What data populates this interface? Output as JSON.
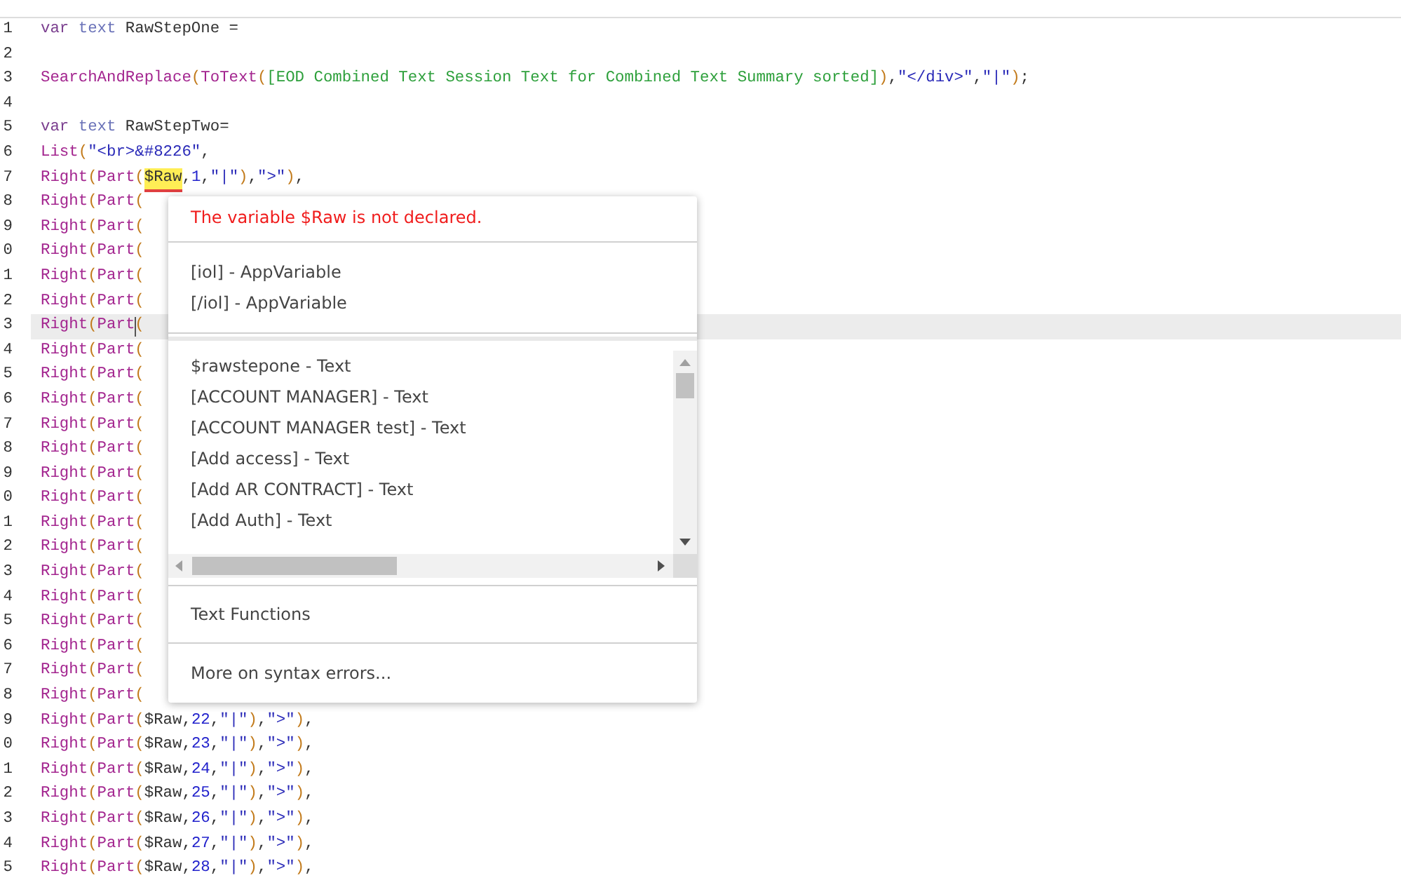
{
  "editor": {
    "lines": [
      {
        "number": "1",
        "current": false,
        "tokens": [
          {
            "kind": "keyword",
            "text": "var "
          },
          {
            "kind": "type",
            "text": "text"
          },
          {
            "kind": "plain",
            "text": " RawStepOne ="
          }
        ]
      },
      {
        "number": "2",
        "current": false
      },
      {
        "number": "3",
        "current": false,
        "tokens": [
          {
            "kind": "function",
            "text": "SearchAndReplace"
          },
          {
            "kind": "paren",
            "text": "("
          },
          {
            "kind": "function",
            "text": "ToText"
          },
          {
            "kind": "paren",
            "text": "("
          },
          {
            "kind": "field",
            "text": "[EOD Combined Text Session Text for Combined Text Summary sorted]"
          },
          {
            "kind": "paren",
            "text": ")"
          },
          {
            "kind": "plain",
            "text": ","
          },
          {
            "kind": "string",
            "text": "\"</div>\""
          },
          {
            "kind": "plain",
            "text": ","
          },
          {
            "kind": "string",
            "text": "\"|\""
          },
          {
            "kind": "paren",
            "text": ")"
          },
          {
            "kind": "plain",
            "text": ";"
          }
        ]
      },
      {
        "number": "4",
        "current": false
      },
      {
        "number": "5",
        "current": false,
        "tokens": [
          {
            "kind": "keyword",
            "text": "var "
          },
          {
            "kind": "type",
            "text": "text"
          },
          {
            "kind": "plain",
            "text": " RawStepTwo="
          }
        ]
      },
      {
        "number": "6",
        "current": false,
        "tokens": [
          {
            "kind": "function",
            "text": "List"
          },
          {
            "kind": "paren",
            "text": "("
          },
          {
            "kind": "string",
            "text": "\"<br>&#8226\""
          },
          {
            "kind": "plain",
            "text": ","
          }
        ]
      },
      {
        "number": "7",
        "current": false,
        "tokens": [
          {
            "kind": "function",
            "text": "Right"
          },
          {
            "kind": "paren",
            "text": "("
          },
          {
            "kind": "function",
            "text": "Part"
          },
          {
            "kind": "paren",
            "text": "("
          },
          {
            "kind": "error",
            "text": "$Raw"
          },
          {
            "kind": "plain",
            "text": ","
          },
          {
            "kind": "number",
            "text": "1"
          },
          {
            "kind": "plain",
            "text": ","
          },
          {
            "kind": "string",
            "text": "\"|\""
          },
          {
            "kind": "paren",
            "text": ")"
          },
          {
            "kind": "plain",
            "text": ","
          },
          {
            "kind": "string",
            "text": "\">\""
          },
          {
            "kind": "paren",
            "text": ")"
          },
          {
            "kind": "plain",
            "text": ","
          }
        ]
      },
      {
        "number": "8",
        "current": false,
        "tokens": [
          {
            "kind": "function",
            "text": "Right"
          },
          {
            "kind": "paren",
            "text": "("
          },
          {
            "kind": "function",
            "text": "Part"
          },
          {
            "kind": "paren",
            "text": "("
          }
        ]
      },
      {
        "number": "9",
        "current": false,
        "tokens": [
          {
            "kind": "function",
            "text": "Right"
          },
          {
            "kind": "paren",
            "text": "("
          },
          {
            "kind": "function",
            "text": "Part"
          },
          {
            "kind": "paren",
            "text": "("
          }
        ]
      },
      {
        "number": "0",
        "current": false,
        "tokens": [
          {
            "kind": "function",
            "text": "Right"
          },
          {
            "kind": "paren",
            "text": "("
          },
          {
            "kind": "function",
            "text": "Part"
          },
          {
            "kind": "paren",
            "text": "("
          }
        ]
      },
      {
        "number": "1",
        "current": false,
        "tokens": [
          {
            "kind": "function",
            "text": "Right"
          },
          {
            "kind": "paren",
            "text": "("
          },
          {
            "kind": "function",
            "text": "Part"
          },
          {
            "kind": "paren",
            "text": "("
          }
        ]
      },
      {
        "number": "2",
        "current": false,
        "tokens": [
          {
            "kind": "function",
            "text": "Right"
          },
          {
            "kind": "paren",
            "text": "("
          },
          {
            "kind": "function",
            "text": "Part"
          },
          {
            "kind": "paren",
            "text": "("
          }
        ]
      },
      {
        "number": "3",
        "current": true,
        "tokens": [
          {
            "kind": "function",
            "text": "Right"
          },
          {
            "kind": "paren",
            "text": "("
          },
          {
            "kind": "function",
            "text": "Part"
          },
          {
            "kind": "paren",
            "text": "("
          }
        ]
      },
      {
        "number": "4",
        "current": false,
        "tokens": [
          {
            "kind": "function",
            "text": "Right"
          },
          {
            "kind": "paren",
            "text": "("
          },
          {
            "kind": "function",
            "text": "Part"
          },
          {
            "kind": "paren",
            "text": "("
          }
        ]
      },
      {
        "number": "5",
        "current": false,
        "tokens": [
          {
            "kind": "function",
            "text": "Right"
          },
          {
            "kind": "paren",
            "text": "("
          },
          {
            "kind": "function",
            "text": "Part"
          },
          {
            "kind": "paren",
            "text": "("
          }
        ]
      },
      {
        "number": "6",
        "current": false,
        "tokens": [
          {
            "kind": "function",
            "text": "Right"
          },
          {
            "kind": "paren",
            "text": "("
          },
          {
            "kind": "function",
            "text": "Part"
          },
          {
            "kind": "paren",
            "text": "("
          }
        ]
      },
      {
        "number": "7",
        "current": false,
        "tokens": [
          {
            "kind": "function",
            "text": "Right"
          },
          {
            "kind": "paren",
            "text": "("
          },
          {
            "kind": "function",
            "text": "Part"
          },
          {
            "kind": "paren",
            "text": "("
          }
        ]
      },
      {
        "number": "8",
        "current": false,
        "tokens": [
          {
            "kind": "function",
            "text": "Right"
          },
          {
            "kind": "paren",
            "text": "("
          },
          {
            "kind": "function",
            "text": "Part"
          },
          {
            "kind": "paren",
            "text": "("
          }
        ]
      },
      {
        "number": "9",
        "current": false,
        "tokens": [
          {
            "kind": "function",
            "text": "Right"
          },
          {
            "kind": "paren",
            "text": "("
          },
          {
            "kind": "function",
            "text": "Part"
          },
          {
            "kind": "paren",
            "text": "("
          }
        ]
      },
      {
        "number": "0",
        "current": false,
        "tokens": [
          {
            "kind": "function",
            "text": "Right"
          },
          {
            "kind": "paren",
            "text": "("
          },
          {
            "kind": "function",
            "text": "Part"
          },
          {
            "kind": "paren",
            "text": "("
          }
        ]
      },
      {
        "number": "1",
        "current": false,
        "tokens": [
          {
            "kind": "function",
            "text": "Right"
          },
          {
            "kind": "paren",
            "text": "("
          },
          {
            "kind": "function",
            "text": "Part"
          },
          {
            "kind": "paren",
            "text": "("
          }
        ]
      },
      {
        "number": "2",
        "current": false,
        "tokens": [
          {
            "kind": "function",
            "text": "Right"
          },
          {
            "kind": "paren",
            "text": "("
          },
          {
            "kind": "function",
            "text": "Part"
          },
          {
            "kind": "paren",
            "text": "("
          }
        ]
      },
      {
        "number": "3",
        "current": false,
        "tokens": [
          {
            "kind": "function",
            "text": "Right"
          },
          {
            "kind": "paren",
            "text": "("
          },
          {
            "kind": "function",
            "text": "Part"
          },
          {
            "kind": "paren",
            "text": "("
          }
        ]
      },
      {
        "number": "4",
        "current": false,
        "tokens": [
          {
            "kind": "function",
            "text": "Right"
          },
          {
            "kind": "paren",
            "text": "("
          },
          {
            "kind": "function",
            "text": "Part"
          },
          {
            "kind": "paren",
            "text": "("
          }
        ]
      },
      {
        "number": "5",
        "current": false,
        "tokens": [
          {
            "kind": "function",
            "text": "Right"
          },
          {
            "kind": "paren",
            "text": "("
          },
          {
            "kind": "function",
            "text": "Part"
          },
          {
            "kind": "paren",
            "text": "("
          }
        ]
      },
      {
        "number": "6",
        "current": false,
        "tokens": [
          {
            "kind": "function",
            "text": "Right"
          },
          {
            "kind": "paren",
            "text": "("
          },
          {
            "kind": "function",
            "text": "Part"
          },
          {
            "kind": "paren",
            "text": "("
          }
        ]
      },
      {
        "number": "7",
        "current": false,
        "tokens": [
          {
            "kind": "function",
            "text": "Right"
          },
          {
            "kind": "paren",
            "text": "("
          },
          {
            "kind": "function",
            "text": "Part"
          },
          {
            "kind": "paren",
            "text": "("
          }
        ]
      },
      {
        "number": "8",
        "current": false,
        "tokens": [
          {
            "kind": "function",
            "text": "Right"
          },
          {
            "kind": "paren",
            "text": "("
          },
          {
            "kind": "function",
            "text": "Part"
          },
          {
            "kind": "paren",
            "text": "("
          }
        ]
      },
      {
        "number": "9",
        "current": false,
        "tokens": [
          {
            "kind": "function",
            "text": "Right"
          },
          {
            "kind": "paren",
            "text": "("
          },
          {
            "kind": "function",
            "text": "Part"
          },
          {
            "kind": "paren",
            "text": "("
          },
          {
            "kind": "plain",
            "text": "$Raw,"
          },
          {
            "kind": "number",
            "text": "22"
          },
          {
            "kind": "plain",
            "text": ","
          },
          {
            "kind": "string",
            "text": "\"|\""
          },
          {
            "kind": "paren",
            "text": ")"
          },
          {
            "kind": "plain",
            "text": ","
          },
          {
            "kind": "string",
            "text": "\">\""
          },
          {
            "kind": "paren",
            "text": ")"
          },
          {
            "kind": "plain",
            "text": ","
          }
        ]
      },
      {
        "number": "0",
        "current": false,
        "tokens": [
          {
            "kind": "function",
            "text": "Right"
          },
          {
            "kind": "paren",
            "text": "("
          },
          {
            "kind": "function",
            "text": "Part"
          },
          {
            "kind": "paren",
            "text": "("
          },
          {
            "kind": "plain",
            "text": "$Raw,"
          },
          {
            "kind": "number",
            "text": "23"
          },
          {
            "kind": "plain",
            "text": ","
          },
          {
            "kind": "string",
            "text": "\"|\""
          },
          {
            "kind": "paren",
            "text": ")"
          },
          {
            "kind": "plain",
            "text": ","
          },
          {
            "kind": "string",
            "text": "\">\""
          },
          {
            "kind": "paren",
            "text": ")"
          },
          {
            "kind": "plain",
            "text": ","
          }
        ]
      },
      {
        "number": "1",
        "current": false,
        "tokens": [
          {
            "kind": "function",
            "text": "Right"
          },
          {
            "kind": "paren",
            "text": "("
          },
          {
            "kind": "function",
            "text": "Part"
          },
          {
            "kind": "paren",
            "text": "("
          },
          {
            "kind": "plain",
            "text": "$Raw,"
          },
          {
            "kind": "number",
            "text": "24"
          },
          {
            "kind": "plain",
            "text": ","
          },
          {
            "kind": "string",
            "text": "\"|\""
          },
          {
            "kind": "paren",
            "text": ")"
          },
          {
            "kind": "plain",
            "text": ","
          },
          {
            "kind": "string",
            "text": "\">\""
          },
          {
            "kind": "paren",
            "text": ")"
          },
          {
            "kind": "plain",
            "text": ","
          }
        ]
      },
      {
        "number": "2",
        "current": false,
        "tokens": [
          {
            "kind": "function",
            "text": "Right"
          },
          {
            "kind": "paren",
            "text": "("
          },
          {
            "kind": "function",
            "text": "Part"
          },
          {
            "kind": "paren",
            "text": "("
          },
          {
            "kind": "plain",
            "text": "$Raw,"
          },
          {
            "kind": "number",
            "text": "25"
          },
          {
            "kind": "plain",
            "text": ","
          },
          {
            "kind": "string",
            "text": "\"|\""
          },
          {
            "kind": "paren",
            "text": ")"
          },
          {
            "kind": "plain",
            "text": ","
          },
          {
            "kind": "string",
            "text": "\">\""
          },
          {
            "kind": "paren",
            "text": ")"
          },
          {
            "kind": "plain",
            "text": ","
          }
        ]
      },
      {
        "number": "3",
        "current": false,
        "tokens": [
          {
            "kind": "function",
            "text": "Right"
          },
          {
            "kind": "paren",
            "text": "("
          },
          {
            "kind": "function",
            "text": "Part"
          },
          {
            "kind": "paren",
            "text": "("
          },
          {
            "kind": "plain",
            "text": "$Raw,"
          },
          {
            "kind": "number",
            "text": "26"
          },
          {
            "kind": "plain",
            "text": ","
          },
          {
            "kind": "string",
            "text": "\"|\""
          },
          {
            "kind": "paren",
            "text": ")"
          },
          {
            "kind": "plain",
            "text": ","
          },
          {
            "kind": "string",
            "text": "\">\""
          },
          {
            "kind": "paren",
            "text": ")"
          },
          {
            "kind": "plain",
            "text": ","
          }
        ]
      },
      {
        "number": "4",
        "current": false,
        "tokens": [
          {
            "kind": "function",
            "text": "Right"
          },
          {
            "kind": "paren",
            "text": "("
          },
          {
            "kind": "function",
            "text": "Part"
          },
          {
            "kind": "paren",
            "text": "("
          },
          {
            "kind": "plain",
            "text": "$Raw,"
          },
          {
            "kind": "number",
            "text": "27"
          },
          {
            "kind": "plain",
            "text": ","
          },
          {
            "kind": "string",
            "text": "\"|\""
          },
          {
            "kind": "paren",
            "text": ")"
          },
          {
            "kind": "plain",
            "text": ","
          },
          {
            "kind": "string",
            "text": "\">\""
          },
          {
            "kind": "paren",
            "text": ")"
          },
          {
            "kind": "plain",
            "text": ","
          }
        ]
      },
      {
        "number": "5",
        "current": false,
        "tokens": [
          {
            "kind": "function",
            "text": "Right"
          },
          {
            "kind": "paren",
            "text": "("
          },
          {
            "kind": "function",
            "text": "Part"
          },
          {
            "kind": "paren",
            "text": "("
          },
          {
            "kind": "plain",
            "text": "$Raw,"
          },
          {
            "kind": "number",
            "text": "28"
          },
          {
            "kind": "plain",
            "text": ","
          },
          {
            "kind": "string",
            "text": "\"|\""
          },
          {
            "kind": "paren",
            "text": ")"
          },
          {
            "kind": "plain",
            "text": ","
          },
          {
            "kind": "string",
            "text": "\">\""
          },
          {
            "kind": "paren",
            "text": ")"
          },
          {
            "kind": "plain",
            "text": ","
          }
        ]
      }
    ]
  },
  "popup": {
    "error_message": "The variable $Raw is not declared.",
    "app_variables": [
      "[iol] - AppVariable",
      "[/iol] - AppVariable"
    ],
    "suggestions": [
      "$rawstepone - Text",
      "[ACCOUNT MANAGER] - Text",
      "[ACCOUNT MANAGER test] - Text",
      "[Add access] - Text",
      "[Add AR CONTRACT] - Text",
      "[Add Auth] - Text"
    ],
    "functions_link": "Text Functions",
    "help_link": "More on syntax errors..."
  }
}
